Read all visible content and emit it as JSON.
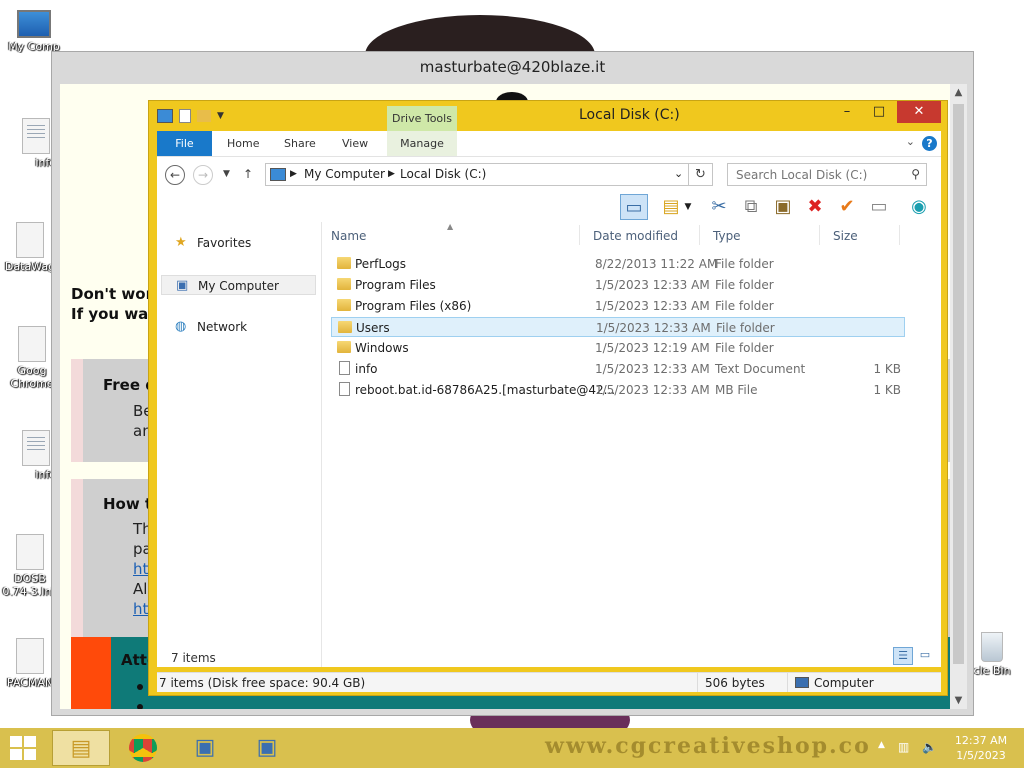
{
  "desktop": {
    "icons": [
      {
        "label": "My Comp",
        "icon": "computer-icon"
      },
      {
        "label": "info",
        "icon": "text-file-icon"
      },
      {
        "label": "DataWag",
        "icon": "file-icon"
      },
      {
        "label": "Goog\nChrome",
        "icon": "file-icon"
      },
      {
        "label": "info",
        "icon": "text-file-icon"
      },
      {
        "label": "DOSB\n0.74-3.lnk",
        "icon": "file-icon"
      },
      {
        "label": "PACMAN",
        "icon": "file-icon"
      },
      {
        "label": "cle Bin",
        "icon": "recycle-bin-icon"
      }
    ]
  },
  "note_window": {
    "title": "masturbate@420blaze.it",
    "dont_worry_line1": "Don't worr",
    "dont_worry_line2": "If you wan",
    "free_heading": "Free dec",
    "free_line1": "Befo",
    "free_line2": "and",
    "howto_heading": "How to",
    "howto_line1": "The",
    "howto_line2": "payr",
    "howto_link1": "https",
    "howto_line3": "Also",
    "howto_link2": "http",
    "attention_heading": "Atte"
  },
  "explorer": {
    "title": "Local Disk (C:)",
    "contextual_tab_group": "Drive Tools",
    "ribbon_tabs": [
      "File",
      "Home",
      "Share",
      "View",
      "Manage"
    ],
    "breadcrumb": [
      "My Computer",
      "Local Disk (C:)"
    ],
    "search_placeholder": "Search Local Disk (C:)",
    "nav_pane": {
      "favorites": "Favorites",
      "my_computer": "My Computer",
      "network": "Network"
    },
    "columns": {
      "name": "Name",
      "date_modified": "Date modified",
      "type": "Type",
      "size": "Size"
    },
    "files": [
      {
        "name": "PerfLogs",
        "date": "8/22/2013 11:22 AM",
        "type": "File folder",
        "size": "",
        "icon": "folder-icon"
      },
      {
        "name": "Program Files",
        "date": "1/5/2023 12:33 AM",
        "type": "File folder",
        "size": "",
        "icon": "folder-icon"
      },
      {
        "name": "Program Files (x86)",
        "date": "1/5/2023 12:33 AM",
        "type": "File folder",
        "size": "",
        "icon": "folder-icon"
      },
      {
        "name": "Users",
        "date": "1/5/2023 12:33 AM",
        "type": "File folder",
        "size": "",
        "icon": "folder-icon",
        "selected": true
      },
      {
        "name": "Windows",
        "date": "1/5/2023 12:19 AM",
        "type": "File folder",
        "size": "",
        "icon": "folder-icon"
      },
      {
        "name": "info",
        "date": "1/5/2023 12:33 AM",
        "type": "Text Document",
        "size": "1 KB",
        "icon": "document-icon"
      },
      {
        "name": "reboot.bat.id-68786A25.[masturbate@42...",
        "date": "1/5/2023 12:33 AM",
        "type": "MB File",
        "size": "1 KB",
        "icon": "document-icon"
      }
    ],
    "item_count": "7 items",
    "status": {
      "items_free": "7 items (Disk free space: 90.4 GB)",
      "size": "506 bytes",
      "location": "Computer"
    }
  },
  "taskbar": {
    "time": "12:37 AM",
    "date": "1/5/2023",
    "watermark": "www.cgcreativeshop.co"
  },
  "colors": {
    "window_frame": "#f0c81e",
    "taskbar": "#d9c04e",
    "file_tab": "#1979ca",
    "close_button": "#c7392f",
    "selection": "#dff0fb",
    "note_bg": "#fffff0"
  }
}
